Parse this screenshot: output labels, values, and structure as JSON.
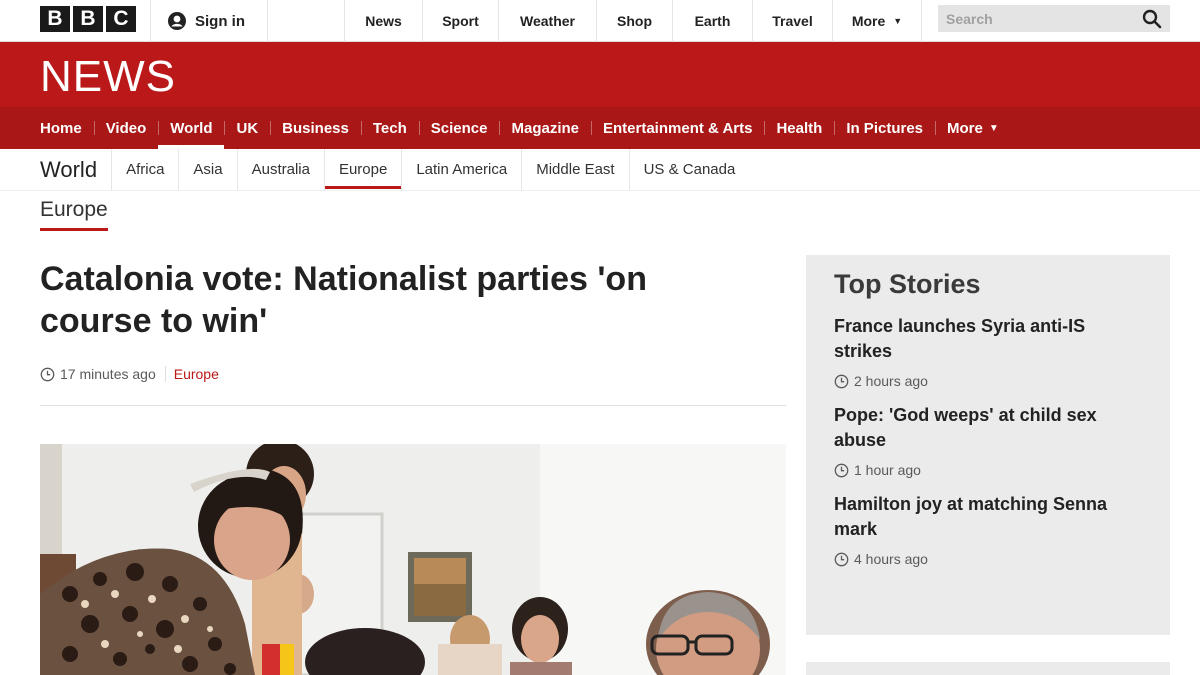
{
  "masthead": {
    "logo_letters": [
      "B",
      "B",
      "C"
    ],
    "signin_label": "Sign in",
    "nav": [
      "News",
      "Sport",
      "Weather",
      "Shop",
      "Earth",
      "Travel",
      "More"
    ],
    "search_placeholder": "Search"
  },
  "banner": {
    "title": "NEWS",
    "color": "#bb1919"
  },
  "section_nav": {
    "items": [
      "Home",
      "Video",
      "World",
      "UK",
      "Business",
      "Tech",
      "Science",
      "Magazine",
      "Entertainment & Arts",
      "Health",
      "In Pictures",
      "More"
    ],
    "active": "World"
  },
  "world_nav": {
    "title": "World",
    "items": [
      "Africa",
      "Asia",
      "Australia",
      "Europe",
      "Latin America",
      "Middle East",
      "US & Canada"
    ],
    "active": "Europe"
  },
  "section_label": "Europe",
  "article": {
    "headline": "Catalonia vote: Nationalist parties 'on course to win'",
    "time": "17 minutes ago",
    "section": "Europe"
  },
  "top_stories": {
    "title": "Top Stories",
    "stories": [
      {
        "headline": "France launches Syria anti-IS strikes",
        "time": "2 hours ago"
      },
      {
        "headline": "Pope: 'God weeps' at child sex abuse",
        "time": "1 hour ago"
      },
      {
        "headline": "Hamilton joy at matching Senna mark",
        "time": "4 hours ago"
      }
    ]
  }
}
